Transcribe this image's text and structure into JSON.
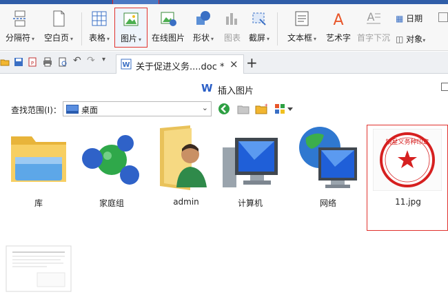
{
  "ribbon": {
    "left_items": [
      {
        "label": "分隔符",
        "icon": "page-break-icon"
      },
      {
        "label": "空白页",
        "icon": "blank-page-icon"
      }
    ],
    "items": [
      {
        "label": "表格",
        "icon": "table-icon"
      },
      {
        "label": "图片",
        "icon": "picture-icon"
      },
      {
        "label": "在线图片",
        "icon": "online-picture-icon"
      },
      {
        "label": "形状",
        "icon": "shapes-icon"
      },
      {
        "label": "图表",
        "icon": "chart-icon"
      },
      {
        "label": "截屏",
        "icon": "screenshot-icon"
      },
      {
        "label": "文本框",
        "icon": "textbox-icon"
      },
      {
        "label": "艺术字",
        "icon": "wordart-icon"
      },
      {
        "label": "首字下沉",
        "icon": "dropcap-icon"
      }
    ],
    "right_items": [
      {
        "label": "日期",
        "icon": "date-icon"
      },
      {
        "label": "对象",
        "icon": "object-icon"
      }
    ]
  },
  "tabbar": {
    "doc_tab": "关于促进义务....doc *",
    "close": "×",
    "new_tab": "+"
  },
  "dialog": {
    "title": "插入图片",
    "lookin_label": "查找范围(I)：",
    "lookin_value": "桌面"
  },
  "files": [
    {
      "name": "库",
      "icon": "library-folder-icon"
    },
    {
      "name": "家庭组",
      "icon": "homegroup-icon"
    },
    {
      "name": "admin",
      "icon": "user-folder-icon"
    },
    {
      "name": "计算机",
      "icon": "computer-icon"
    },
    {
      "name": "网络",
      "icon": "network-icon"
    },
    {
      "name": "11.jpg",
      "icon": "seal-image-icon"
    },
    {
      "name": "",
      "icon": "document-thumbnail-icon"
    }
  ],
  "seal_text": "镜星义务种印章",
  "colors": {
    "accent": "#2f5da8",
    "highlight": "#e0302c",
    "seal": "#d62020"
  }
}
